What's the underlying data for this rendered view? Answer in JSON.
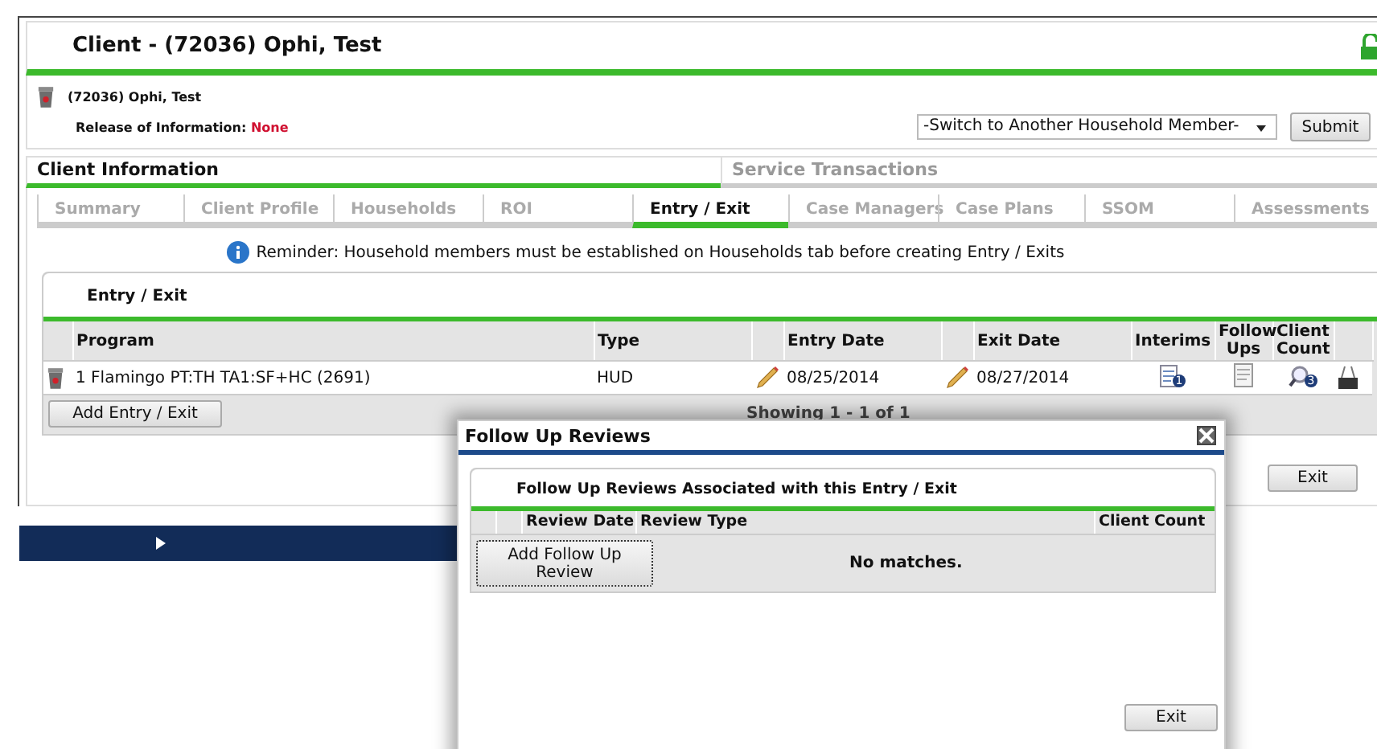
{
  "header": {
    "title": "Client - (72036) Ophi, Test"
  },
  "client": {
    "name": "(72036) Ophi, Test",
    "roi_label": "Release of Information:",
    "roi_value": "None"
  },
  "household_select": {
    "value": "-Switch to Another Household Member-"
  },
  "submit_button": "Submit",
  "main_tabs": [
    {
      "label": "Client Information",
      "selected": true
    },
    {
      "label": "Service Transactions",
      "selected": false
    }
  ],
  "sub_tabs": [
    {
      "label": "Summary",
      "selected": false
    },
    {
      "label": "Client Profile",
      "selected": false
    },
    {
      "label": "Households",
      "selected": false
    },
    {
      "label": "ROI",
      "selected": false
    },
    {
      "label": "Entry / Exit",
      "selected": true
    },
    {
      "label": "Case Managers",
      "selected": false
    },
    {
      "label": "Case Plans",
      "selected": false
    },
    {
      "label": "SSOM",
      "selected": false
    },
    {
      "label": "Assessments",
      "selected": false
    }
  ],
  "reminder": "Reminder: Household members must be established on Households tab before creating Entry / Exits",
  "entry_exit": {
    "title": "Entry / Exit",
    "columns": [
      "Program",
      "Type",
      "Entry Date",
      "Exit Date",
      "Interims",
      "Follow Ups",
      "Client Count"
    ],
    "rows": [
      {
        "program": "1 Flamingo PT:TH TA1:SF+HC (2691)",
        "type": "HUD",
        "entry_date": "08/25/2014",
        "exit_date": "08/27/2014",
        "interims_count": "1",
        "client_count": "3"
      }
    ],
    "add_button": "Add Entry / Exit",
    "footer": "Showing 1 - 1 of 1"
  },
  "exit_button": "Exit",
  "modal": {
    "title": "Follow Up Reviews",
    "section_title": "Follow Up Reviews Associated with this Entry / Exit",
    "columns": [
      "Review Date",
      "Review Type",
      "Client Count"
    ],
    "add_button": "Add Follow Up Review",
    "empty_text": "No matches.",
    "exit_button": "Exit"
  }
}
